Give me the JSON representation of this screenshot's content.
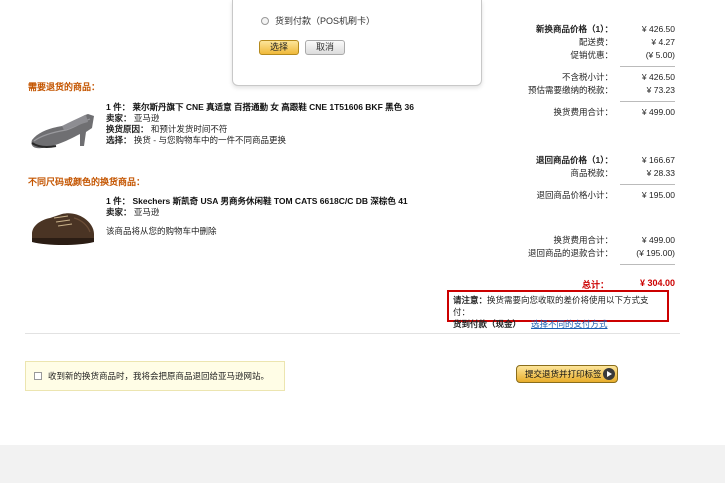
{
  "popup": {
    "option_label": "货到付款（POS机刷卡）",
    "select_label": "选择",
    "cancel_label": "取消"
  },
  "sections": {
    "return_title": "需要退货的商品：",
    "exchange_title": "不同尺码或颜色的换货商品："
  },
  "return_item": {
    "name": "1 件： 莱尔斯丹旗下 CNE 真适意 百搭通勤 女 高跟鞋 CNE 1T51606 BKF 黑色 36",
    "seller_label": "卖家：",
    "seller": "亚马逊",
    "reason_label": "换货原因：",
    "reason": "和预计发货时间不符",
    "choice_label": "选择：",
    "choice": "换货 - 与您购物车中的一件不同商品更换"
  },
  "exchange_item": {
    "name": "1 件： Skechers 斯凯奇 USA 男商务休闲鞋 TOM CATS 6618C/C DB 深棕色 41",
    "seller_label": "卖家：",
    "seller": "亚马逊",
    "note": "该商品将从您的购物车中删除"
  },
  "summary": {
    "new_price_label": "新换商品价格（1）：",
    "new_price": "¥ 426.50",
    "shipping_label": "配送费：",
    "shipping": "¥ 4.27",
    "promo_label": "促销优惠：",
    "promo": "(¥ 5.00)",
    "pretax_label": "不含税小计：",
    "pretax": "¥ 426.50",
    "est_tax_label": "预估需要缴纳的税款：",
    "est_tax": "¥ 73.23",
    "exchange_total_label": "换货费用合计：",
    "exchange_total": "¥ 499.00",
    "return_price_label": "退回商品价格（1）：",
    "return_price": "¥ 166.67",
    "item_tax_label": "商品税款：",
    "item_tax": "¥ 28.33",
    "return_subtotal_label": "退回商品价格小计：",
    "return_subtotal": "¥ 195.00",
    "exchange_total2_label": "换货费用合计：",
    "exchange_total2": "¥ 499.00",
    "refund_total_label": "退回商品的退款合计：",
    "refund_total": "(¥ 195.00)",
    "grand_total_label": "总计：",
    "grand_total": "¥ 304.00"
  },
  "notice": {
    "prefix": "请注意：",
    "text": "换货需要向您收取的差价将使用以下方式支付：",
    "method": "货到付款（现金）",
    "link": "选择不同的支付方式"
  },
  "gift": {
    "label": "收到新的换货商品时，我将会把原商品退回给亚马逊网站。"
  },
  "submit": {
    "label": "提交退货并打印标签"
  },
  "colors": {
    "accent": "#c45500",
    "alert": "#cc0000",
    "link": "#1a5fb4"
  }
}
